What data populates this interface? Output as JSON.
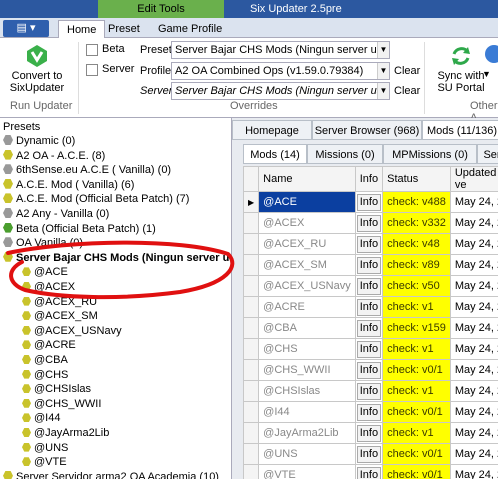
{
  "window": {
    "title": "Six Updater 2.5pre",
    "context_tab": "Edit Tools"
  },
  "ribbon_tabs": [
    "Home",
    "Preset",
    "Game Profile"
  ],
  "ribbon": {
    "convert_label": "Convert to\nSixUpdater",
    "run_group": "Run Updater",
    "beta_label": "Beta",
    "server_label": "Server",
    "preset_label": "Preset",
    "preset_value": "Server Bajar CHS Mods (Ningun server usa TODOS",
    "profile_label": "Profile",
    "profile_value": "A2 OA Combined Ops (v1.59.0.79384)",
    "server_field_label": "Server",
    "server_value": "Server Bajar CHS Mods (Ningun server usa TODOS los",
    "clear1": "Clear",
    "clear2": "Clear",
    "overrides_group": "Overrides",
    "sync_label": "Sync with\nSU Portal",
    "other_group": "Other A"
  },
  "tree": {
    "header": "Presets",
    "items": [
      {
        "label": "Dynamic (0)",
        "icon": "gray",
        "indent": 0
      },
      {
        "label": "A2 OA - A.C.E. (8)",
        "icon": "yellow",
        "indent": 0
      },
      {
        "label": "6thSense.eu A.C.E ( Vanilla) (0)",
        "icon": "gray",
        "indent": 0
      },
      {
        "label": "A.C.E. Mod ( Vanilla) (6)",
        "icon": "yellow",
        "indent": 0
      },
      {
        "label": "A.C.E. Mod (Official Beta Patch) (7)",
        "icon": "yellow",
        "indent": 0
      },
      {
        "label": "A2 Any - Vanilla (0)",
        "icon": "gray",
        "indent": 0
      },
      {
        "label": "Beta (Official Beta Patch) (1)",
        "icon": "green",
        "indent": 0
      },
      {
        "label": "OA Vanilla (0)",
        "icon": "gray",
        "indent": 0
      },
      {
        "label": "Server Bajar CHS Mods (Ningun server usa",
        "icon": "yellow",
        "indent": 0,
        "bold": true
      },
      {
        "label": "@ACE",
        "icon": "yellow",
        "indent": 1
      },
      {
        "label": "@ACEX",
        "icon": "yellow",
        "indent": 1
      },
      {
        "label": "@ACEX_RU",
        "icon": "yellow",
        "indent": 1
      },
      {
        "label": "@ACEX_SM",
        "icon": "yellow",
        "indent": 1
      },
      {
        "label": "@ACEX_USNavy",
        "icon": "yellow",
        "indent": 1
      },
      {
        "label": "@ACRE",
        "icon": "yellow",
        "indent": 1
      },
      {
        "label": "@CBA",
        "icon": "yellow",
        "indent": 1
      },
      {
        "label": "@CHS",
        "icon": "yellow",
        "indent": 1
      },
      {
        "label": "@CHSIslas",
        "icon": "yellow",
        "indent": 1
      },
      {
        "label": "@CHS_WWII",
        "icon": "yellow",
        "indent": 1
      },
      {
        "label": "@I44",
        "icon": "yellow",
        "indent": 1
      },
      {
        "label": "@JayArma2Lib",
        "icon": "yellow",
        "indent": 1
      },
      {
        "label": "@UNS",
        "icon": "yellow",
        "indent": 1
      },
      {
        "label": "@VTE",
        "icon": "yellow",
        "indent": 1
      },
      {
        "label": "Server Servidor arma2 OA Academia (10)",
        "icon": "yellow",
        "indent": 0
      }
    ]
  },
  "top_tabs": [
    "Homepage",
    "Server Browser (968)",
    "Mods (11/136)"
  ],
  "sub_tabs": [
    "Mods (14)",
    "Missions (0)",
    "MPMissions (0)",
    "Ser"
  ],
  "grid": {
    "columns": [
      "",
      "Name",
      "Info",
      "Status",
      "Updated ve"
    ],
    "info_label": "Info",
    "rows": [
      {
        "name": "@ACE",
        "status": "check: v488",
        "date": "May 24, 20",
        "current": true
      },
      {
        "name": "@ACEX",
        "status": "check: v332",
        "date": "May 24, 20"
      },
      {
        "name": "@ACEX_RU",
        "status": "check: v48",
        "date": "May 24, 20"
      },
      {
        "name": "@ACEX_SM",
        "status": "check: v89",
        "date": "May 24, 20"
      },
      {
        "name": "@ACEX_USNavy",
        "status": "check: v50",
        "date": "May 24, 20"
      },
      {
        "name": "@ACRE",
        "status": "check: v1",
        "date": "May 24, 20"
      },
      {
        "name": "@CBA",
        "status": "check: v159",
        "date": "May 24, 20"
      },
      {
        "name": "@CHS",
        "status": "check: v1",
        "date": "May 24, 20"
      },
      {
        "name": "@CHS_WWII",
        "status": "check: v0/1",
        "date": "May 24, 20"
      },
      {
        "name": "@CHSIslas",
        "status": "check: v1",
        "date": "May 24, 20"
      },
      {
        "name": "@I44",
        "status": "check: v0/1",
        "date": "May 24, 20"
      },
      {
        "name": "@JayArma2Lib",
        "status": "check: v1",
        "date": "May 24, 20"
      },
      {
        "name": "@UNS",
        "status": "check: v0/1",
        "date": "May 24, 20"
      },
      {
        "name": "@VTE",
        "status": "check: v0/1",
        "date": "May 24, 20"
      }
    ]
  },
  "colors": {
    "title_bar": "#2c58a0",
    "context_tab": "#6ab04c",
    "status_bg": "#ffff00",
    "selection": "#0b3fa0",
    "annotation": "#e01010"
  }
}
